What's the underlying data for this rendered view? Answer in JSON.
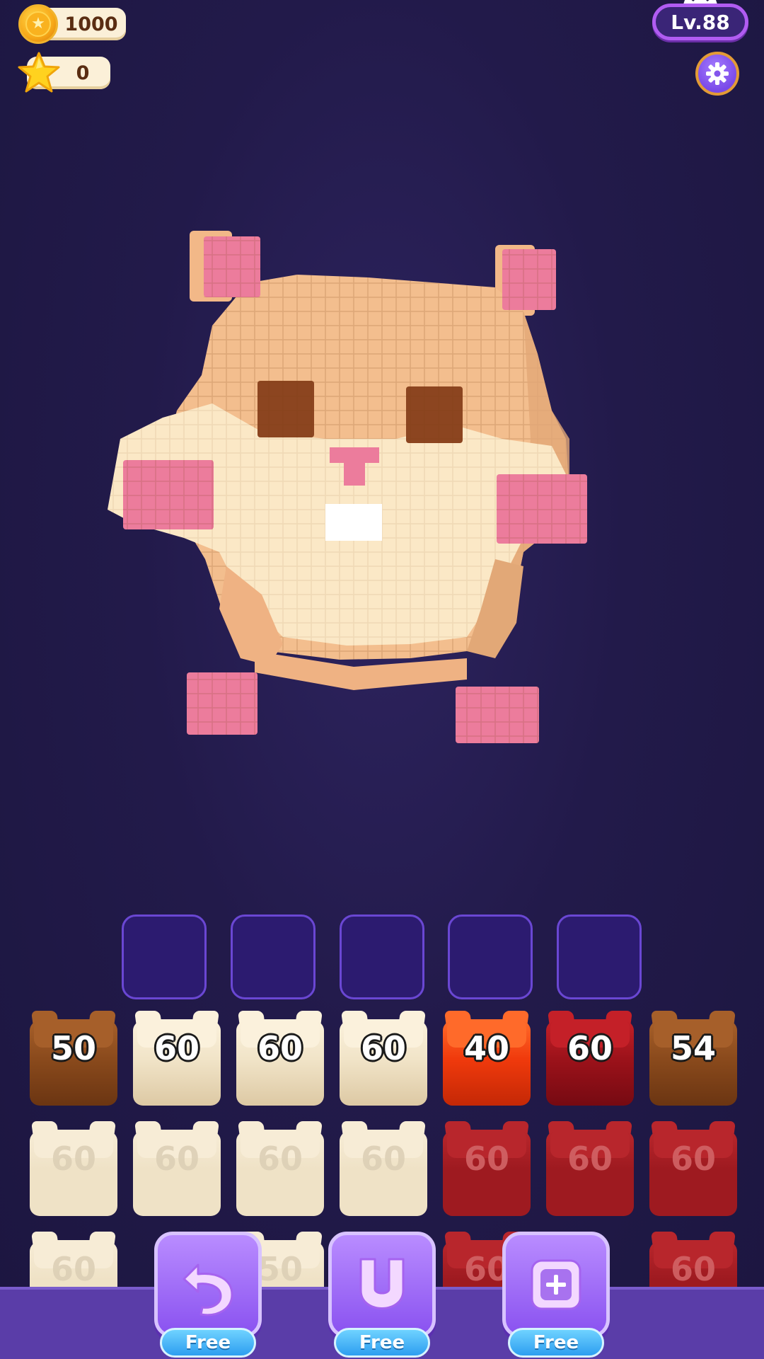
{
  "hud": {
    "coins": "1000",
    "stars": "0",
    "level": "Lv.88"
  },
  "colors": {
    "cream": "#f6ead0",
    "brown": "#8a4a1c",
    "orange_red": "#ff4a10",
    "dark_red": "#a8141c",
    "accent_purple": "#8a52f0"
  },
  "slots": [
    "",
    "",
    "",
    "",
    ""
  ],
  "blocks": {
    "row1": [
      {
        "value": "50",
        "color": "brown"
      },
      {
        "value": "60",
        "color": "cream"
      },
      {
        "value": "60",
        "color": "cream"
      },
      {
        "value": "60",
        "color": "cream"
      },
      {
        "value": "40",
        "color": "orange_red"
      },
      {
        "value": "60",
        "color": "dark_red"
      },
      {
        "value": "54",
        "color": "brown"
      }
    ],
    "row2": [
      {
        "value": "60",
        "color": "cream"
      },
      {
        "value": "60",
        "color": "cream"
      },
      {
        "value": "60",
        "color": "cream"
      },
      {
        "value": "60",
        "color": "cream"
      },
      {
        "value": "60",
        "color": "dark_red"
      },
      {
        "value": "60",
        "color": "dark_red"
      },
      {
        "value": "60",
        "color": "dark_red"
      }
    ],
    "row3_visible": [
      {
        "value": "60",
        "color": "cream"
      },
      {
        "value": "50",
        "color": "cream"
      },
      {
        "value": "60",
        "color": "dark_red"
      },
      {
        "value": "60",
        "color": "dark_red"
      }
    ]
  },
  "boosters": [
    {
      "icon": "undo-arrow-icon",
      "label": "Free"
    },
    {
      "icon": "magnet-icon",
      "label": "Free"
    },
    {
      "icon": "add-slot-icon",
      "label": "Free"
    }
  ]
}
